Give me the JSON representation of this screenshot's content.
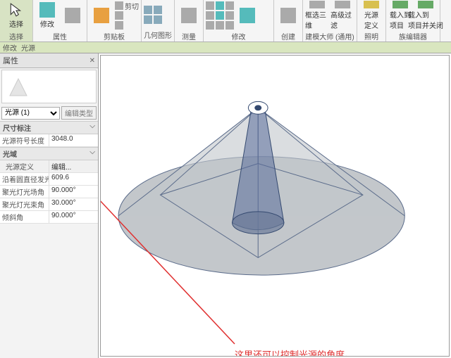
{
  "ribbon": {
    "select_label": "选择",
    "modify_label": "修改",
    "props_label": "属性",
    "clipboard_label": "剪贴板",
    "cut": "剪切",
    "copy": "",
    "paste": "",
    "geom_label": "几何图形",
    "measure_label": "测量",
    "modify2_label": "修改",
    "create_label": "创建",
    "box3d": "框选三维",
    "advfilter": "高级过滤",
    "model_master": "建模大师 (通用)",
    "light_def": "光源\n定义",
    "lighting_label": "照明",
    "load_proj": "载入到\n项目",
    "load_close": "载入到\n项目并关闭",
    "family_editor": "族编辑器"
  },
  "tabs": {
    "a": "修改",
    "b": "光源"
  },
  "panel": {
    "title": "属性",
    "type_sel": "光源 (1)",
    "edit_type": "编辑类型",
    "sec_dim": "尺寸标注",
    "p_symlen_k": "光源符号长度",
    "p_symlen_v": "3048.0",
    "sec_light": "光域",
    "p_def_k": "光源定义",
    "p_def_v": "编辑...",
    "p_emit_k": "沿着圆直径发光",
    "p_emit_v": "609.6",
    "p_field_k": "聚光灯光场角",
    "p_field_v": "90.000°",
    "p_beam_k": "聚光灯光束角",
    "p_beam_v": "30.000°",
    "p_tilt_k": "倾斜角",
    "p_tilt_v": "90.000°"
  },
  "annot": "这里还可以控制光源的角度。"
}
